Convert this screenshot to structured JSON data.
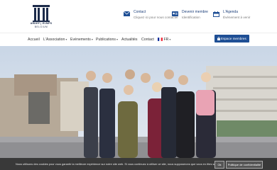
{
  "logo": {
    "name": "ARDEF | EVMPS",
    "subtitle": "BELGIUM"
  },
  "header": {
    "contact": {
      "title": "Contact",
      "subtitle": "Cliquez ici pour nous contacter"
    },
    "membership": {
      "title": "Devenir membre",
      "subtitle": "Identification"
    },
    "agenda": {
      "title": "L'Agenda",
      "subtitle": "Événement à venir"
    }
  },
  "nav": {
    "items": [
      {
        "label": "Accueil",
        "dropdown": false
      },
      {
        "label": "L'Association",
        "dropdown": true
      },
      {
        "label": "Evénements",
        "dropdown": true
      },
      {
        "label": "Publications",
        "dropdown": true
      },
      {
        "label": "Actualités",
        "dropdown": false
      },
      {
        "label": "Contact",
        "dropdown": false
      },
      {
        "label": "FR",
        "dropdown": true
      }
    ],
    "member_button": "Espace membres"
  },
  "cookie": {
    "message": "Nous utilisons des cookies pour vous garantir la meilleure expérience sur notre site web. Si vous continuez à utiliser ce site, nous supposerons que vous en êtes satisfait.",
    "ok": "Ok",
    "policy": "Politique de confidentialité"
  },
  "colors": {
    "primary": "#1f4f95",
    "navy": "#1c2b4a",
    "cookie_bg": "#323232"
  }
}
